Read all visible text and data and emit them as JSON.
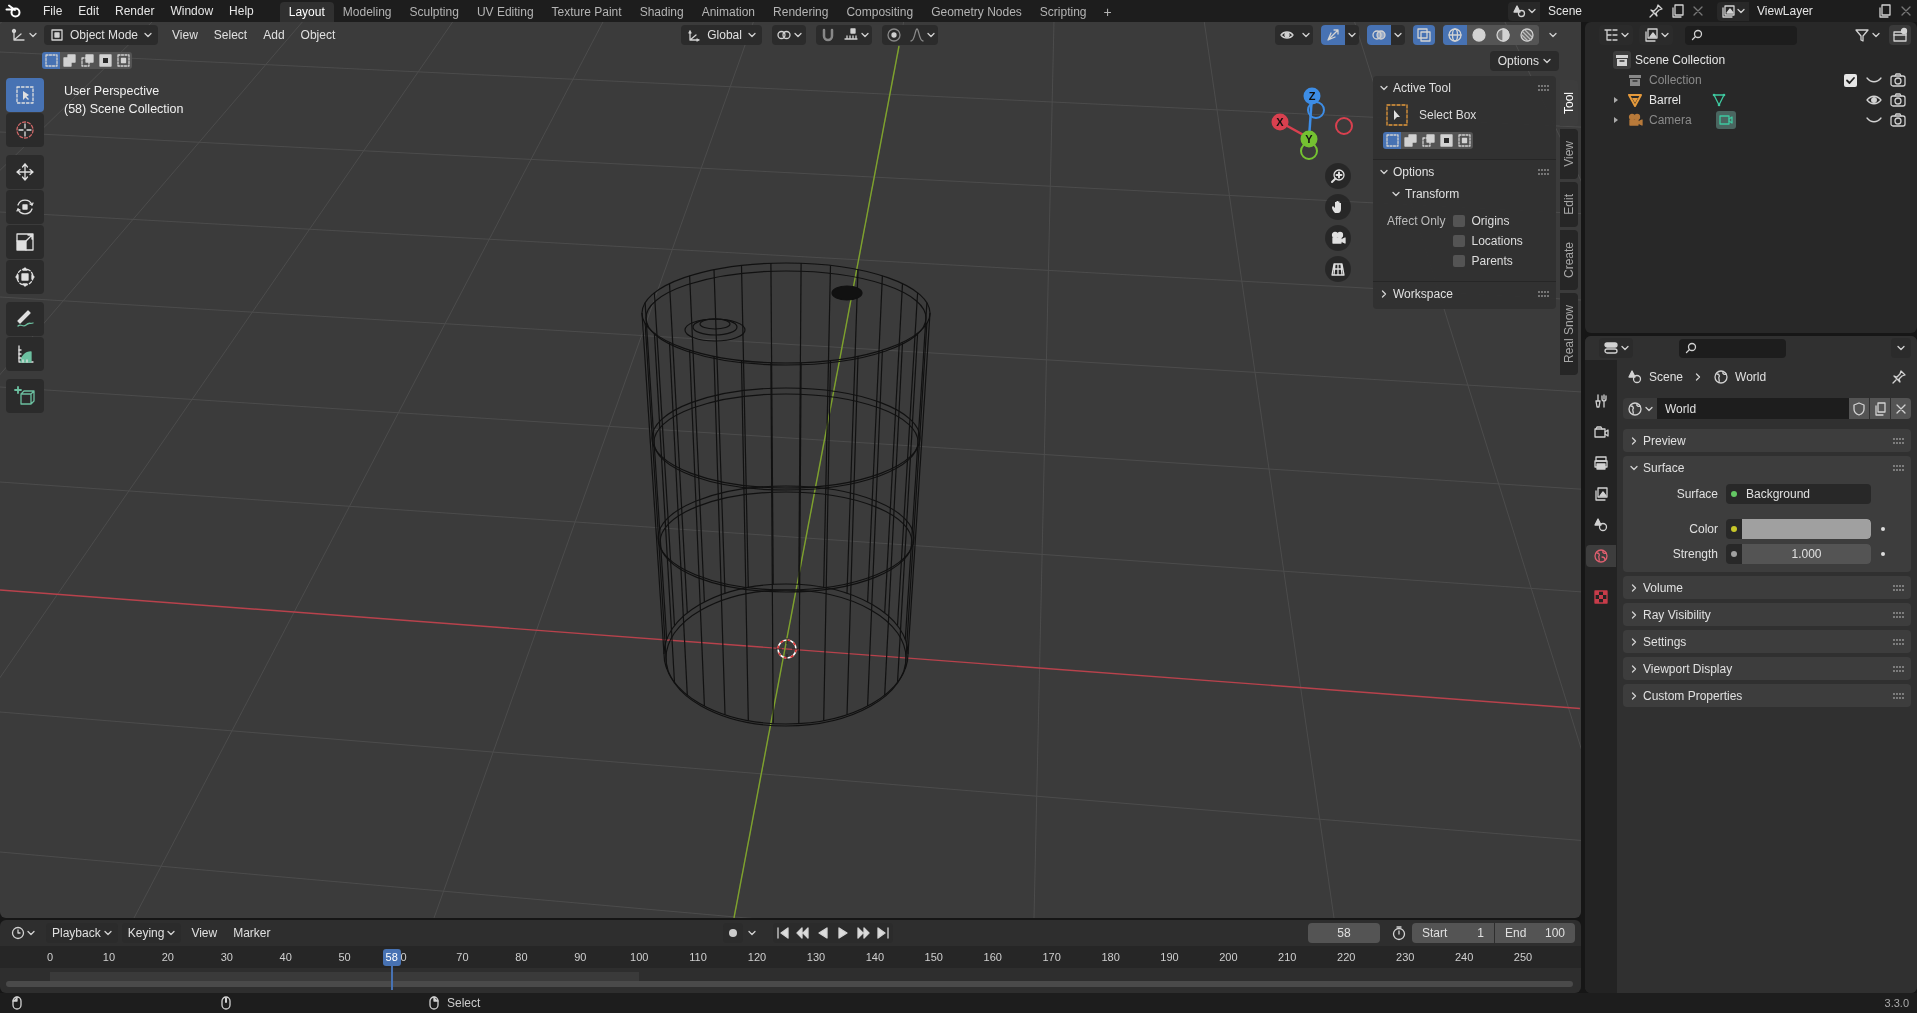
{
  "topbar": {
    "menus": [
      "File",
      "Edit",
      "Render",
      "Window",
      "Help"
    ],
    "workspaces": [
      {
        "label": "Layout",
        "selected": true
      },
      {
        "label": "Modeling",
        "selected": false
      },
      {
        "label": "Sculpting",
        "selected": false
      },
      {
        "label": "UV Editing",
        "selected": false
      },
      {
        "label": "Texture Paint",
        "selected": false
      },
      {
        "label": "Shading",
        "selected": false
      },
      {
        "label": "Animation",
        "selected": false
      },
      {
        "label": "Rendering",
        "selected": false
      },
      {
        "label": "Compositing",
        "selected": false
      },
      {
        "label": "Geometry Nodes",
        "selected": false
      },
      {
        "label": "Scripting",
        "selected": false
      }
    ],
    "add_tab": "+",
    "scene": "Scene",
    "view_layer": "ViewLayer"
  },
  "viewport": {
    "mode": "Object Mode",
    "menus": [
      "View",
      "Select",
      "Add",
      "Object"
    ],
    "orientation": "Global",
    "options": "Options",
    "info": [
      "User Perspective",
      "(58) Scene Collection"
    ],
    "select_modes": [
      {
        "kind": "set",
        "selected": true
      },
      {
        "kind": "extend",
        "selected": false
      },
      {
        "kind": "subtract",
        "selected": false
      },
      {
        "kind": "invert",
        "selected": false
      },
      {
        "kind": "intersect",
        "selected": false
      }
    ],
    "toggles": [
      {
        "kind": "visibility",
        "on": false
      },
      {
        "kind": "gizmos",
        "on": true
      },
      {
        "kind": "overlays",
        "on": true
      },
      {
        "kind": "xray",
        "on": true
      }
    ],
    "shading": [
      {
        "kind": "wireframe",
        "selected": true
      },
      {
        "kind": "solid",
        "selected": false
      },
      {
        "kind": "material",
        "selected": false
      },
      {
        "kind": "rendered",
        "selected": false
      }
    ],
    "tools": [
      {
        "kind": "select_box",
        "selected": true
      },
      {
        "kind": "cursor",
        "selected": false
      },
      {
        "kind": "move",
        "selected": false
      },
      {
        "kind": "rotate",
        "selected": false
      },
      {
        "kind": "scale",
        "selected": false
      },
      {
        "kind": "transform",
        "selected": false
      },
      {
        "kind": "annotate",
        "selected": false
      },
      {
        "kind": "measure",
        "selected": false
      },
      {
        "kind": "add_cube",
        "selected": false
      }
    ],
    "gizmo": [
      {
        "label": "X",
        "color": "#d9404f"
      },
      {
        "label": "Y",
        "color": "#74c231"
      },
      {
        "label": "Z",
        "color": "#3d8de6"
      }
    ],
    "n_tabs": [
      {
        "label": "Tool",
        "selected": true
      },
      {
        "label": "View",
        "selected": false
      },
      {
        "label": "Edit",
        "selected": false
      },
      {
        "label": "Create",
        "selected": false
      },
      {
        "label": "Real Snow",
        "selected": false
      }
    ],
    "n_panel": {
      "active_tool": {
        "title": "Active Tool",
        "expanded": true,
        "tool": "Select Box",
        "modes": [
          {
            "kind": "set",
            "selected": true
          },
          {
            "kind": "extend",
            "selected": false
          },
          {
            "kind": "subtract",
            "selected": false
          },
          {
            "kind": "invert",
            "selected": false
          },
          {
            "kind": "intersect",
            "selected": false
          }
        ]
      },
      "options": {
        "title": "Options",
        "expanded": true,
        "transform": {
          "title": "Transform",
          "expanded": true
        },
        "affect_label": "Affect Only",
        "checkboxes": [
          {
            "label": "Origins",
            "checked": false
          },
          {
            "label": "Locations",
            "checked": false
          },
          {
            "label": "Parents",
            "checked": false
          }
        ]
      },
      "workspace": {
        "title": "Workspace",
        "expanded": false
      }
    }
  },
  "outliner": {
    "root": {
      "label": "Scene Collection",
      "children": [
        {
          "label": "Collection",
          "kind": "collection",
          "visible": false,
          "checked": true
        },
        {
          "label": "Barrel",
          "kind": "mesh",
          "visible": true,
          "expanded": false
        },
        {
          "label": "Camera",
          "kind": "camera",
          "visible": false,
          "expanded": false
        }
      ]
    }
  },
  "properties": {
    "tabs": [
      {
        "kind": "tool",
        "selected": false
      },
      {
        "kind": "render",
        "selected": false
      },
      {
        "kind": "output",
        "selected": false
      },
      {
        "kind": "view_layer",
        "selected": false
      },
      {
        "kind": "scene",
        "selected": false
      },
      {
        "kind": "world",
        "selected": true
      },
      {
        "kind": "texture",
        "selected": false
      }
    ],
    "breadcrumb": [
      "Scene",
      "World"
    ],
    "datablock": "World",
    "panels": [
      {
        "label": "Preview",
        "expanded": false
      },
      {
        "label": "Surface",
        "expanded": true,
        "fields": [
          {
            "kind": "shader",
            "label": "Surface",
            "value": "Background"
          },
          {
            "kind": "color",
            "label": "Color"
          },
          {
            "kind": "number",
            "label": "Strength",
            "value": "1.000"
          }
        ]
      },
      {
        "label": "Volume",
        "expanded": false
      },
      {
        "label": "Ray Visibility",
        "expanded": false
      },
      {
        "label": "Settings",
        "expanded": false
      },
      {
        "label": "Viewport Display",
        "expanded": false
      },
      {
        "label": "Custom Properties",
        "expanded": false
      }
    ]
  },
  "timeline": {
    "menus": [
      "Playback",
      "Keying",
      "View",
      "Marker"
    ],
    "current_frame": "58",
    "start_label": "Start",
    "start": "1",
    "end_label": "End",
    "end": "100",
    "ruler": [
      "0",
      "10",
      "20",
      "30",
      "40",
      "50",
      "0",
      "70",
      "80",
      "90",
      "100",
      "110",
      "120",
      "130",
      "140",
      "150",
      "160",
      "170",
      "180",
      "190",
      "200",
      "210",
      "220",
      "230",
      "240",
      "250"
    ],
    "playhead": {
      "label": "58",
      "level": 0.232
    }
  },
  "status": {
    "hints": [
      {
        "kind": "left"
      },
      {
        "kind": "middle"
      },
      {
        "kind": "right",
        "label": "Select"
      }
    ],
    "version": "3.3.0"
  }
}
